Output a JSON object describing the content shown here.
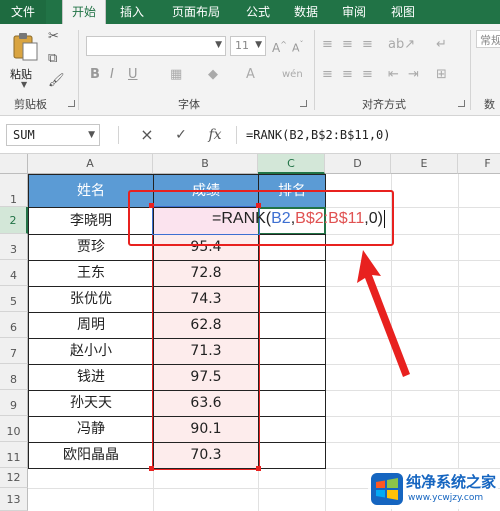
{
  "ribbon": {
    "tabs": [
      "文件",
      "开始",
      "插入",
      "页面布局",
      "公式",
      "数据",
      "审阅",
      "视图"
    ],
    "active_tab": "开始",
    "groups": {
      "clipboard": "剪贴板",
      "font": "字体",
      "alignment": "对齐方式",
      "number_cut": "数"
    },
    "paste_label": "粘贴",
    "font_size": "11",
    "number_format": "常规"
  },
  "formula_bar": {
    "name_box": "SUM",
    "cancel_icon": "×",
    "enter_icon": "✓",
    "fx_label": "fx",
    "formula": "=RANK(B2,B$2:B$11,0)"
  },
  "columns": [
    "A",
    "B",
    "C",
    "D",
    "E",
    "F"
  ],
  "rows": [
    "1",
    "2",
    "3",
    "4",
    "5",
    "6",
    "7",
    "8",
    "9",
    "10",
    "11",
    "12",
    "13"
  ],
  "table": {
    "headers": [
      "姓名",
      "成绩",
      "排名"
    ],
    "names": [
      "李晓明",
      "贾珍",
      "王东",
      "张优优",
      "周明",
      "赵小小",
      "钱进",
      "孙天天",
      "冯静",
      "欧阳晶晶"
    ],
    "scores": [
      "",
      "95.4",
      "72.8",
      "74.3",
      "62.8",
      "71.3",
      "97.5",
      "63.6",
      "90.1",
      "70.3"
    ]
  },
  "in_cell_formula": {
    "prefix": "=RANK(",
    "ref1": "B2",
    "sep1": ",",
    "ref2": "B$2:B$11",
    "suffix": ",0)"
  },
  "watermark": {
    "title": "纯净系统之家",
    "url": "www.ycwjzy.com"
  },
  "colors": {
    "excel_green": "#217346",
    "header_blue": "#5b9bd5",
    "annotation_red": "#e8211f"
  }
}
